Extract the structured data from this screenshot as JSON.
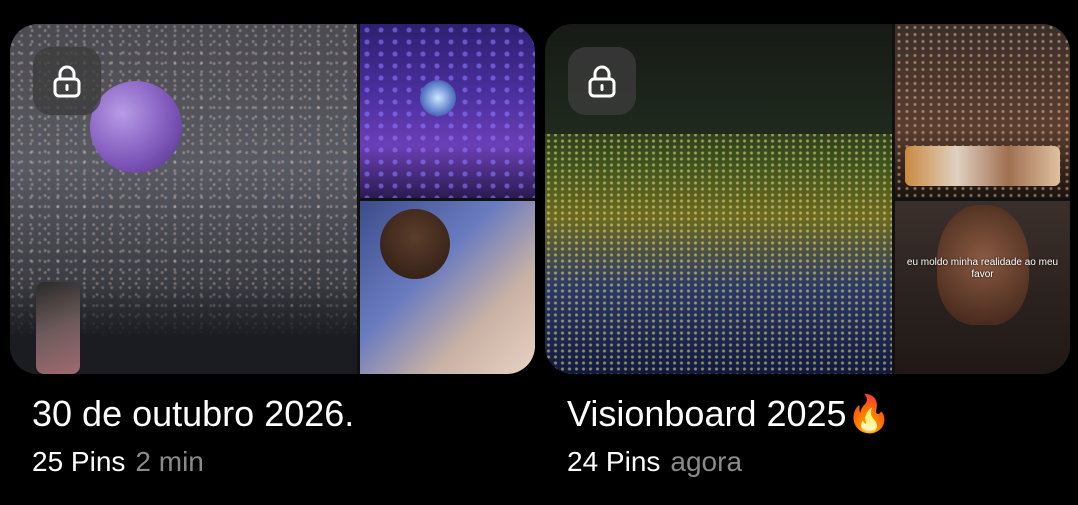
{
  "boards": [
    {
      "title": "30 de outubro 2026.",
      "pins": "25 Pins",
      "time": "2 min",
      "locked": true,
      "lock_icon": "lock-icon"
    },
    {
      "title": "Visionboard 2025🔥",
      "pins": "24 Pins",
      "time": "agora",
      "locked": true,
      "lock_icon": "lock-icon",
      "image_caption": "eu moldo minha realidade ao meu favor"
    }
  ],
  "colors": {
    "background": "#000000",
    "title": "#ffffff",
    "timestamp": "#8a8a8a",
    "lock_badge": "#3c3c3c"
  }
}
